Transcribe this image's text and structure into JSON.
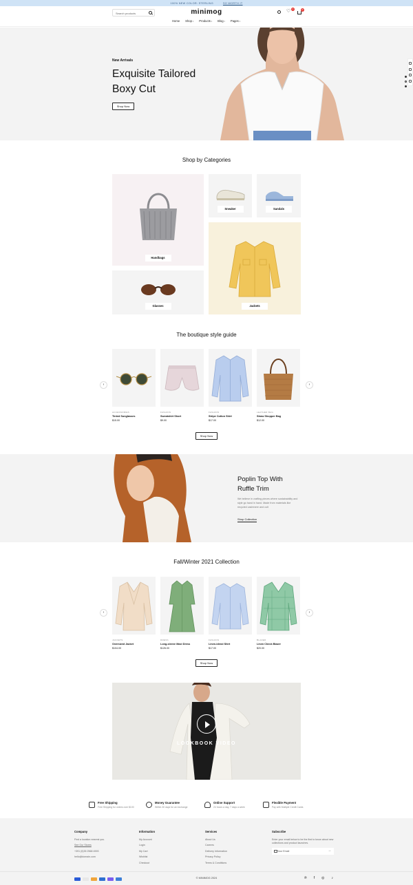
{
  "announcement": {
    "text": "100% NEW COLOR: STERLING",
    "cta": "SO WORTH IT"
  },
  "header": {
    "search_placeholder": "Search products",
    "logo": "minimog",
    "wishlist_count": "0",
    "cart_count": "0",
    "nav": [
      "Home",
      "Shop",
      "Products",
      "Blog",
      "Pages"
    ]
  },
  "hero": {
    "kicker": "New Arrivals",
    "title": "Exquisite Tailored Boxy Cut",
    "button": "Shop Now"
  },
  "categories": {
    "title": "Shop by Categories",
    "items": [
      "Handbags",
      "Sneaker",
      "Sandals",
      "Glasses",
      "Jackets"
    ]
  },
  "style_guide": {
    "title": "The boutique style guide",
    "button": "Shop Now",
    "products": [
      {
        "category": "ACCESSORIES",
        "name": "Tinted Sunglasses",
        "price": "$15.00"
      },
      {
        "category": "FASHION",
        "name": "Sweatshirt Short",
        "price": "$9.00"
      },
      {
        "category": "FASHION",
        "name": "Stripe Cotton Shirt",
        "price": "$17.00"
      },
      {
        "category": "LEATHER BAG",
        "name": "Straw Shopper Bag",
        "price": "$12.00"
      }
    ]
  },
  "banner": {
    "title": "Poplin Top With Ruffle Trim",
    "body": "We believe in crafting pieces where sustainability and style go hand in hand. Made from materials like recycled cashmere and cult",
    "link": "Shop Collection"
  },
  "collection": {
    "title": "Fall/Winter 2021 Collection",
    "button": "Shop Now",
    "products": [
      {
        "category": "JACKETS",
        "name": "Oversized Jacket",
        "price": "$104.00"
      },
      {
        "category": "DRESS",
        "name": "Long-sleeve Maxi Dress",
        "price": "$126.00"
      },
      {
        "category": "FASHION",
        "name": "Linen-blend Shirt",
        "price": "$17.00"
      },
      {
        "category": "BLAZER",
        "name": "Linen Check Blazer",
        "price": "$20.00"
      }
    ]
  },
  "video": {
    "label": "LOOKBOOK VIDEO"
  },
  "features": [
    {
      "title": "Free Shipping",
      "sub": "Free Shipping for orders over $100"
    },
    {
      "title": "Money Guarantee",
      "sub": "Within 30 days for an exchange"
    },
    {
      "title": "Online Support",
      "sub": "24 hours a day, 7 days a week"
    },
    {
      "title": "Flexible Payment",
      "sub": "Pay with Multiple Credit Cards"
    }
  ],
  "footer": {
    "company": {
      "title": "Company",
      "lines": [
        "Find a location nearest you.",
        "See Our Stores",
        "+391 (0)35 2568 4593",
        "hello@domain.com"
      ]
    },
    "information": {
      "title": "Information",
      "links": [
        "My Account",
        "Login",
        "My Cart",
        "Wishlist",
        "Checkout"
      ]
    },
    "services": {
      "title": "Services",
      "links": [
        "About Us",
        "Careers",
        "Delivery Information",
        "Privacy Policy",
        "Terms & Conditions"
      ]
    },
    "subscribe": {
      "title": "Subscribe",
      "body": "Enter your email below to be the first to know about new collections and product launches.",
      "placeholder": "Your Email"
    },
    "copyright": "© MINIMOG 2024"
  },
  "colors": {
    "announcement_bg": "#cfe3f6",
    "badge": "#e53935",
    "card_bg": "#f4f4f4",
    "handbag_bg": "#f7f1f3",
    "jacket_bg": "#f8f1dc"
  }
}
